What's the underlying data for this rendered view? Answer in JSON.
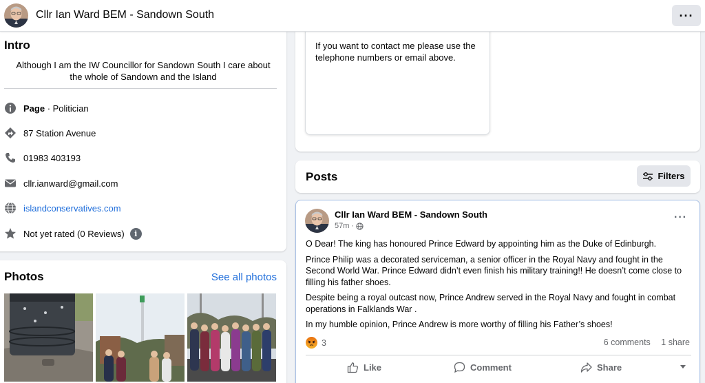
{
  "header": {
    "title": "Cllr Ian Ward BEM - Sandown South",
    "more_icon": "ellipsis-icon"
  },
  "intro": {
    "title": "Intro",
    "bio": "Although I am the IW Councillor for Sandown South I care about the whole of Sandown and the Island",
    "page_label": "Page",
    "page_category": " · Politician",
    "address": "87 Station Avenue",
    "phone": "01983 403193",
    "email": "cllr.ianward@gmail.com",
    "website": "islandconservatives.com",
    "rating": "Not yet rated (0 Reviews)",
    "rating_info": "i"
  },
  "photos": {
    "title": "Photos",
    "see_all": "See all photos"
  },
  "contact": {
    "text": "If you want to contact me please use the telephone numbers or email above."
  },
  "posts": {
    "title": "Posts",
    "filters_label": "Filters"
  },
  "post": {
    "author": "Cllr Ian Ward BEM - Sandown South",
    "time": "57m",
    "separator": " · ",
    "paragraphs": [
      "O Dear!  The king has honoured Prince Edward by appointing him as the Duke of Edinburgh.",
      "Prince Philip was a decorated serviceman, a senior officer in the Royal Navy and fought in the Second World War.  Prince Edward didn’t even finish his military training!!  He doesn’t come close to filling his father shoes.",
      "Despite being a royal outcast now, Prince Andrew served in the Royal Navy and fought in combat operations in Falklands War .",
      "In my humble opinion, Prince Andrew is more worthy of filling his Father’s shoes!"
    ],
    "reaction_count": "3",
    "comments": "6 comments",
    "shares": "1 share",
    "like_label": "Like",
    "comment_label": "Comment",
    "share_label": "Share"
  },
  "colors": {
    "link": "#216fdb",
    "muted": "#65676b",
    "background": "#f0f2f5"
  }
}
